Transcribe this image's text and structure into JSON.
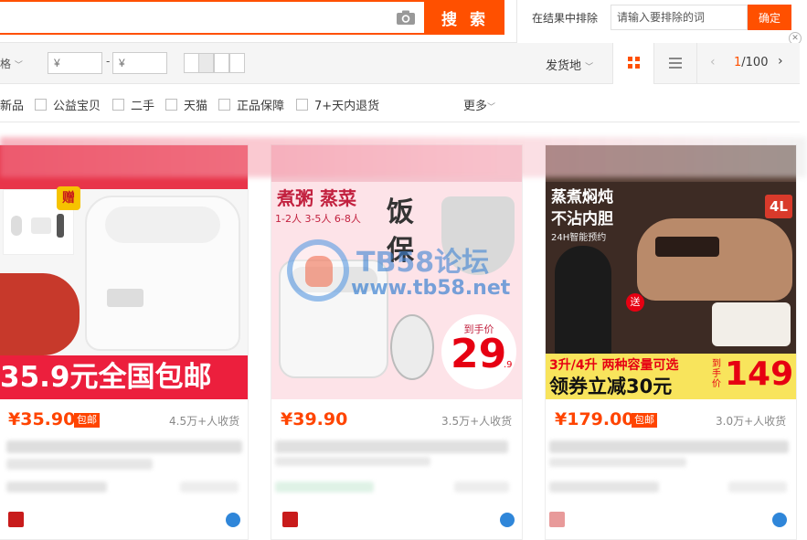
{
  "search": {
    "button_label": "搜 索",
    "placeholder": ""
  },
  "exclude": {
    "label": "在结果中排除",
    "placeholder": "请输入要排除的词",
    "confirm_label": "确定"
  },
  "filter1": {
    "price_suffix": "格",
    "currency": "¥",
    "dash": "-",
    "ship_from_label": "发货地",
    "pager_current": "1",
    "pager_total": "/100"
  },
  "filter2": {
    "partial_label": "新品",
    "options": [
      "公益宝贝",
      "二手",
      "天猫",
      "正品保障",
      "7+天内退货"
    ],
    "more_label": "更多"
  },
  "watermark": {
    "title": "TB58论坛",
    "url": "www.tb58.net"
  },
  "products": [
    {
      "price": "¥35.90",
      "badge": "包邮",
      "sales": "4.5万+人收货",
      "banner_text": "35.9元全国包邮",
      "gift_label": "赠"
    },
    {
      "price": "¥39.90",
      "badge": "",
      "sales": "3.5万+人收货",
      "headline": "煮粥 蒸菜",
      "capacities": "1-2人  3-5人  6-8人",
      "side_text_1": "饭",
      "side_text_2": "保",
      "price_tag_label": "到手价",
      "price_tag_value": "29",
      "price_tag_decimal": ".9"
    },
    {
      "price": "¥179.00",
      "badge": "包邮",
      "sales": "3.0万+人收货",
      "headline_1": "蒸煮焖炖",
      "headline_2": "不沾内胆",
      "subline": "24H智能预约",
      "capacity_tag": "4L",
      "gift_label": "送",
      "promo_1": "3升/4升 两种容量可选",
      "promo_2": "领券立减30元",
      "price_tag_label": "到手价",
      "price_tag_value": "149"
    }
  ]
}
